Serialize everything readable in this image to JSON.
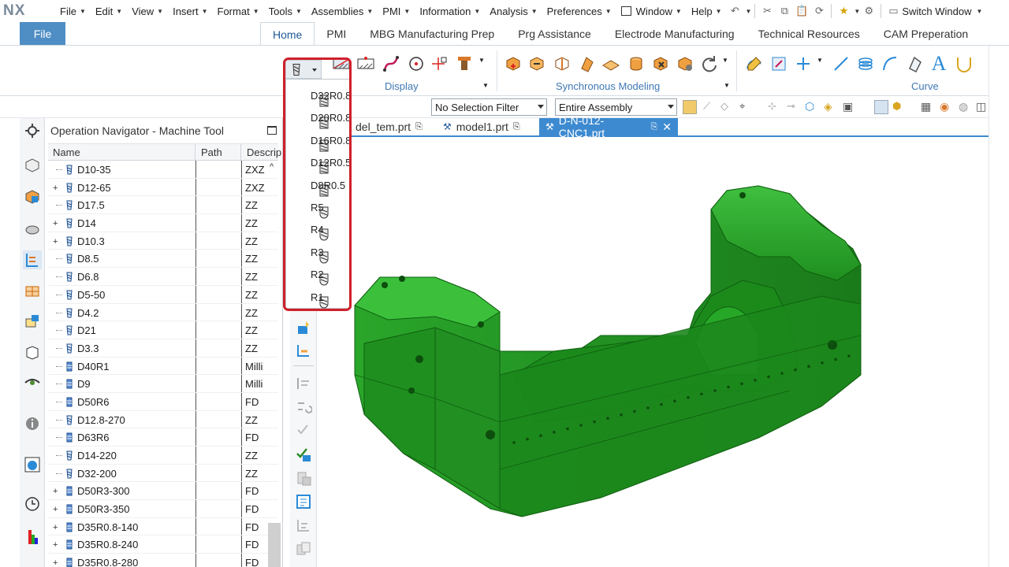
{
  "app": {
    "logo": "NX"
  },
  "menu": {
    "items": [
      "File",
      "Edit",
      "View",
      "Insert",
      "Format",
      "Tools",
      "Assemblies",
      "PMI",
      "Information",
      "Analysis",
      "Preferences",
      "Window",
      "Help"
    ],
    "underline": [
      "F",
      "E",
      "V",
      "I",
      "r",
      "T",
      "A",
      "P",
      "I",
      "A",
      "P",
      "W",
      "H"
    ],
    "switch_window": "Switch Window"
  },
  "ribbon": {
    "file_tab": "File",
    "tabs": [
      "Home",
      "PMI",
      "MBG Manufacturing Prep",
      "Prg Assistance",
      "Electrode Manufacturing",
      "Technical Resources",
      "CAM Preperation"
    ],
    "active_tab": "Home",
    "groups": {
      "display": "Display",
      "sync": "Synchronous Modeling",
      "curve": "Curve"
    }
  },
  "selection": {
    "filter": "No Selection Filter",
    "scope": "Entire Assembly"
  },
  "navigator": {
    "title": "Operation Navigator - Machine Tool",
    "columns": {
      "name": "Name",
      "path": "Path",
      "desc": "Descrip"
    },
    "rows": [
      {
        "name": "D10-35",
        "desc": "ZXZ",
        "expand": false,
        "icon": "ball"
      },
      {
        "name": "D12-65",
        "desc": "ZXZ",
        "expand": true,
        "icon": "ball"
      },
      {
        "name": "D17.5",
        "desc": "ZZ",
        "expand": false,
        "icon": "ball"
      },
      {
        "name": "D14",
        "desc": "ZZ",
        "expand": true,
        "icon": "ball"
      },
      {
        "name": "D10.3",
        "desc": "ZZ",
        "expand": true,
        "icon": "ball"
      },
      {
        "name": "D8.5",
        "desc": "ZZ",
        "expand": false,
        "icon": "ball"
      },
      {
        "name": "D6.8",
        "desc": "ZZ",
        "expand": false,
        "icon": "ball"
      },
      {
        "name": "D5-50",
        "desc": "ZZ",
        "expand": false,
        "icon": "ball"
      },
      {
        "name": "D4.2",
        "desc": "ZZ",
        "expand": false,
        "icon": "ball"
      },
      {
        "name": "D21",
        "desc": "ZZ",
        "expand": false,
        "icon": "ball"
      },
      {
        "name": "D3.3",
        "desc": "ZZ",
        "expand": false,
        "icon": "ball"
      },
      {
        "name": "D40R1",
        "desc": "Milli",
        "expand": false,
        "icon": "mill"
      },
      {
        "name": "D9",
        "desc": "Milli",
        "expand": false,
        "icon": "mill"
      },
      {
        "name": "D50R6",
        "desc": "FD",
        "expand": false,
        "icon": "mill"
      },
      {
        "name": "D12.8-270",
        "desc": "ZZ",
        "expand": false,
        "icon": "ball"
      },
      {
        "name": "D63R6",
        "desc": "FD",
        "expand": false,
        "icon": "mill"
      },
      {
        "name": "D14-220",
        "desc": "ZZ",
        "expand": false,
        "icon": "ball"
      },
      {
        "name": "D32-200",
        "desc": "ZZ",
        "expand": false,
        "icon": "ball"
      },
      {
        "name": "D50R3-300",
        "desc": "FD",
        "expand": true,
        "icon": "mill"
      },
      {
        "name": "D50R3-350",
        "desc": "FD",
        "expand": true,
        "icon": "mill"
      },
      {
        "name": "D35R0.8-140",
        "desc": "FD",
        "expand": true,
        "icon": "mill"
      },
      {
        "name": "D35R0.8-240",
        "desc": "FD",
        "expand": true,
        "icon": "mill"
      },
      {
        "name": "D35R0.8-280",
        "desc": "FD",
        "expand": true,
        "icon": "mill"
      }
    ]
  },
  "tool_menu": {
    "items": [
      "D32R0.8",
      "D20R0.8",
      "D16R0.8",
      "D12R0.5",
      "D8R0.5",
      "R5",
      "R4",
      "R3",
      "R2",
      "R1"
    ]
  },
  "documents": {
    "tabs": [
      {
        "label": "del_tem.prt",
        "active": false
      },
      {
        "label": "model1.prt",
        "active": false
      },
      {
        "label": "D-N-012-CNC1.prt",
        "active": true
      }
    ]
  },
  "colors": {
    "accent": "#3d8ad0",
    "file_tab": "#4f8ec4",
    "model": "#2f9e2f",
    "highlight": "#d0202a"
  }
}
